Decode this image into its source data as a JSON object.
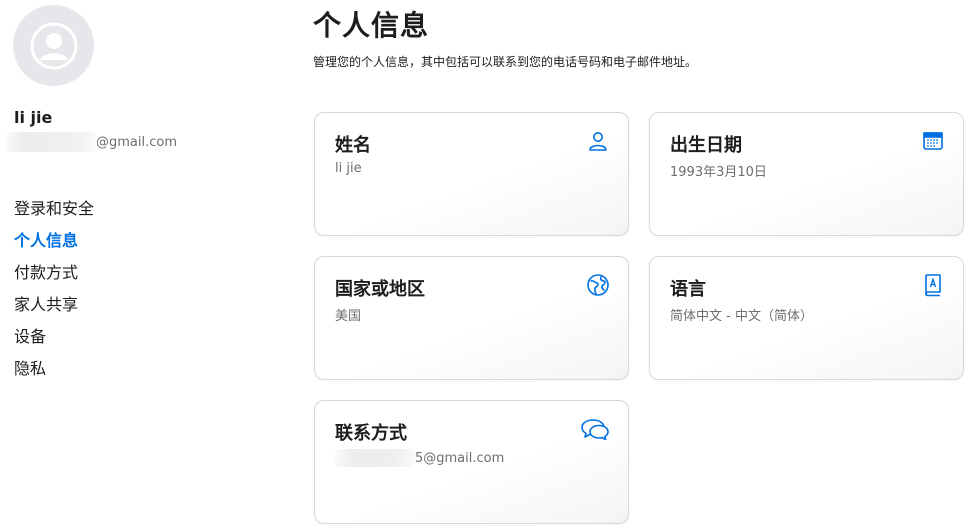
{
  "sidebar": {
    "user_name": "li jie",
    "user_email_domain": "@gmail.com",
    "nav": [
      {
        "label": "登录和安全",
        "active": false
      },
      {
        "label": "个人信息",
        "active": true
      },
      {
        "label": "付款方式",
        "active": false
      },
      {
        "label": "家人共享",
        "active": false
      },
      {
        "label": "设备",
        "active": false
      },
      {
        "label": "隐私",
        "active": false
      }
    ]
  },
  "main": {
    "title": "个人信息",
    "description": "管理您的个人信息，其中包括可以联系到您的电话号码和电子邮件地址。",
    "cards": {
      "name": {
        "title": "姓名",
        "value": "li jie",
        "icon": "person-icon"
      },
      "birthday": {
        "title": "出生日期",
        "value": "1993年3月10日",
        "icon": "calendar-icon"
      },
      "region": {
        "title": "国家或地区",
        "value": "美国",
        "icon": "globe-icon"
      },
      "language": {
        "title": "语言",
        "value": "简体中文 - 中文（简体）",
        "icon": "language-book-icon"
      },
      "contact": {
        "title": "联系方式",
        "value_suffix": "5@gmail.com",
        "icon": "chat-bubbles-icon"
      }
    }
  },
  "colors": {
    "accent": "#0071e3",
    "text": "#1d1d1f",
    "secondary_text": "#6e6e73",
    "card_border": "#d8d8dd",
    "avatar_bg": "#e6e6eb"
  }
}
